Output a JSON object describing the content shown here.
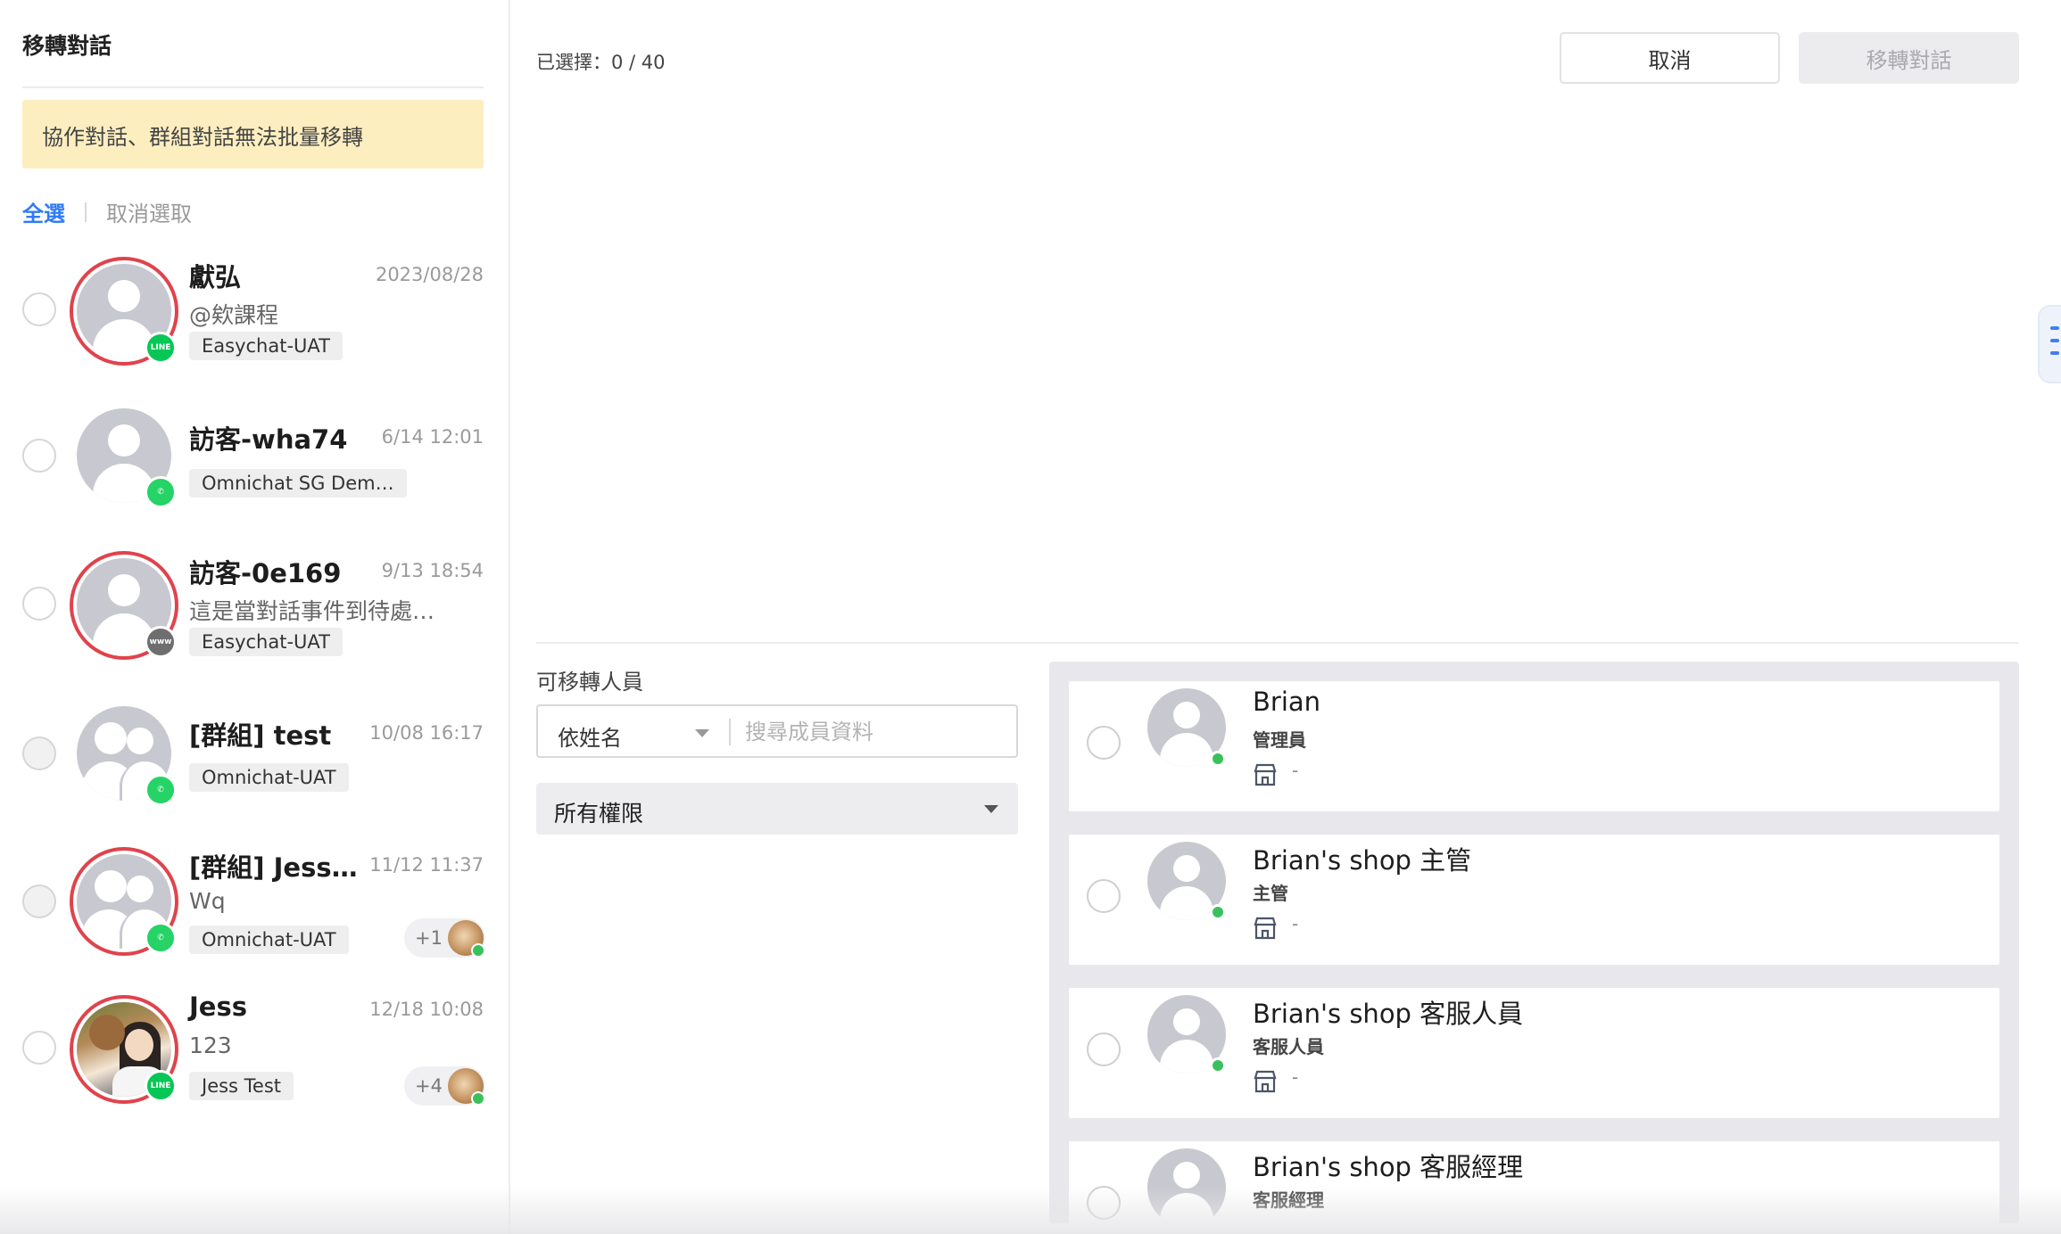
{
  "left_panel": {
    "title": "移轉對話",
    "notice": "協作對話、群組對話無法批量移轉",
    "select_all": "全選",
    "deselect": "取消選取"
  },
  "conversations": [
    {
      "name": "獻弘",
      "time": "2023/08/28",
      "preview": "@欸課程",
      "tag": "Easychat-UAT",
      "channel": "line",
      "channel_icon": "line-icon",
      "ring": true,
      "avatar": "default"
    },
    {
      "name": "訪客-wha74",
      "time": "6/14 12:01",
      "preview": "",
      "tag": "Omnichat SG Dem…",
      "channel": "whatsapp",
      "channel_icon": "whatsapp-icon",
      "ring": false,
      "avatar": "default"
    },
    {
      "name": "訪客-0e169",
      "time": "9/13 18:54",
      "preview": "這是當對話事件到待處…",
      "tag": "Easychat-UAT",
      "channel": "web",
      "channel_icon": "web-icon",
      "channel_text": "www",
      "ring": true,
      "avatar": "default"
    },
    {
      "name": "[群組] test",
      "time": "10/08 16:17",
      "preview": "",
      "tag": "Omnichat-UAT",
      "channel": "whatsapp",
      "channel_icon": "whatsapp-icon",
      "ring": false,
      "avatar": "group"
    },
    {
      "name": "[群組] Jess…",
      "time": "11/12 11:37",
      "preview": "Wq",
      "tag": "Omnichat-UAT",
      "channel": "whatsapp",
      "channel_icon": "whatsapp-icon",
      "ring": true,
      "avatar": "group",
      "more": "+1"
    },
    {
      "name": "Jess",
      "time": "12/18 10:08",
      "preview": "123",
      "tag": "Jess Test",
      "channel": "line",
      "channel_icon": "line-icon",
      "ring": true,
      "avatar": "photo",
      "more": "+4"
    }
  ],
  "header": {
    "selected_count": "已選擇：0 / 40",
    "cancel_label": "取消",
    "transfer_label": "移轉對話"
  },
  "members_section": {
    "label": "可移轉人員",
    "sort_by": "依姓名",
    "search_placeholder": "搜尋成員資料",
    "role_filter": "所有權限"
  },
  "members": [
    {
      "name": "Brian",
      "role": "管理員",
      "shop": "-"
    },
    {
      "name": "Brian's shop 主管",
      "role": "主管",
      "shop": "-"
    },
    {
      "name": "Brian's shop 客服人員",
      "role": "客服人員",
      "shop": "-"
    },
    {
      "name": "Brian's shop 客服經理",
      "role": "客服經理",
      "shop": "-"
    }
  ],
  "colors": {
    "accent": "#2f7bf5",
    "ring": "#e0434c",
    "online": "#3ac15c",
    "notice_bg": "#fdeec0",
    "line": "#06c755",
    "whatsapp": "#25d366"
  }
}
